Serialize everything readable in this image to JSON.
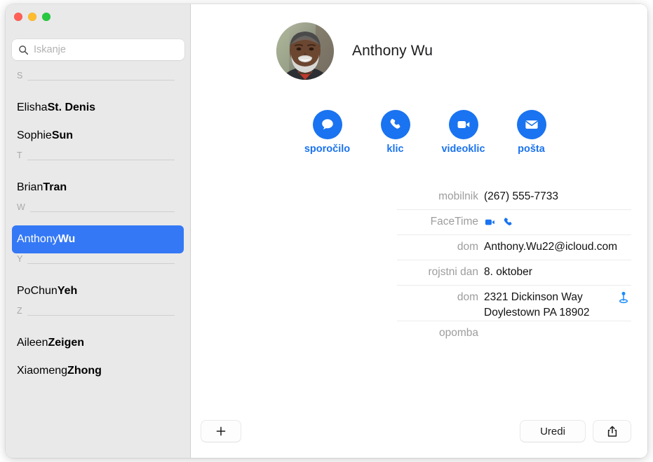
{
  "window": {
    "traffic_lights": [
      {
        "name": "close",
        "color": "#ff5f57"
      },
      {
        "name": "minimize",
        "color": "#febc2e"
      },
      {
        "name": "zoom",
        "color": "#28c840"
      }
    ]
  },
  "sidebar": {
    "search": {
      "placeholder": "Iskanje",
      "value": "",
      "icon": "search-icon"
    },
    "sections": [
      {
        "letter": "S",
        "contacts": [
          {
            "first": "Elisha ",
            "last": "St. Denis",
            "selected": false
          },
          {
            "first": "Sophie ",
            "last": "Sun",
            "selected": false
          }
        ]
      },
      {
        "letter": "T",
        "contacts": [
          {
            "first": "Brian ",
            "last": "Tran",
            "selected": false
          }
        ]
      },
      {
        "letter": "W",
        "contacts": [
          {
            "first": "Anthony ",
            "last": "Wu",
            "selected": true
          }
        ]
      },
      {
        "letter": "Y",
        "contacts": [
          {
            "first": "PoChun ",
            "last": "Yeh",
            "selected": false
          }
        ]
      },
      {
        "letter": "Z",
        "contacts": [
          {
            "first": "Aileen ",
            "last": "Zeigen",
            "selected": false
          },
          {
            "first": "Xiaomeng ",
            "last": "Zhong",
            "selected": false
          }
        ]
      }
    ],
    "selection_color": "#3478f6"
  },
  "detail": {
    "name": "Anthony Wu",
    "avatar": {
      "icon": "contact-photo",
      "alt": "Photo of Anthony Wu"
    },
    "accent_color": "#1a73f0",
    "actions": [
      {
        "label": "sporočilo",
        "icon": "message-bubble-icon"
      },
      {
        "label": "klic",
        "icon": "phone-icon"
      },
      {
        "label": "videoklic",
        "icon": "video-camera-icon"
      },
      {
        "label": "pošta",
        "icon": "envelope-icon"
      }
    ],
    "fields": [
      {
        "label": "mobilnik",
        "value": "(267) 555-7733",
        "type": "text"
      },
      {
        "label": "FaceTime",
        "value": "",
        "type": "facetime",
        "icons": [
          "video-camera-icon",
          "phone-icon"
        ]
      },
      {
        "label": "dom",
        "value": "Anthony.Wu22@icloud.com",
        "type": "text"
      },
      {
        "label": "rojstni dan",
        "value": "8. oktober",
        "type": "text"
      },
      {
        "label": "dom",
        "value": "2321 Dickinson Way",
        "value2": "Doylestown PA 18902",
        "type": "address",
        "trailing_icon": "map-pin-icon"
      },
      {
        "label": "opomba",
        "value": "",
        "type": "text"
      }
    ]
  },
  "toolbar": {
    "add_label": "+",
    "edit_label": "Uredi",
    "share_icon": "share-icon"
  }
}
